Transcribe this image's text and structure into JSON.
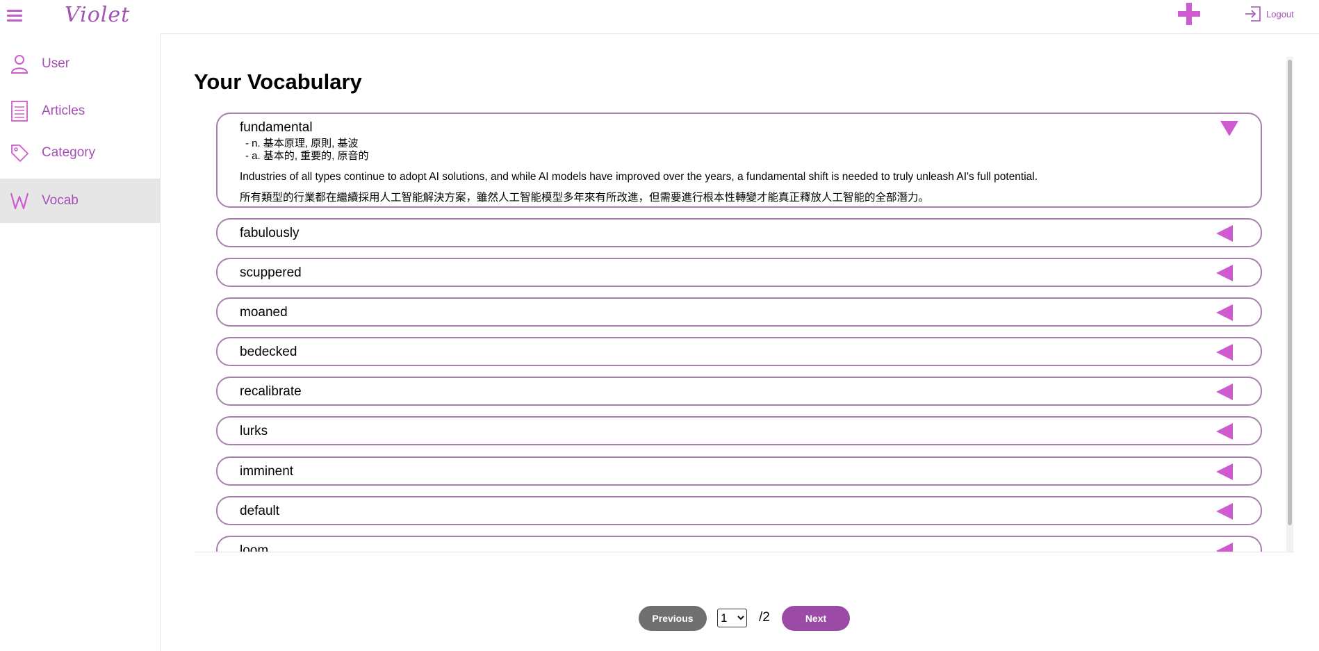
{
  "app": {
    "logo": "Violet",
    "brand_color": "#a450b5",
    "accent_color": "#cf5bd0"
  },
  "header": {
    "menu_icon": "hamburger-icon",
    "add_icon": "plus-icon",
    "logout_icon": "logout-icon",
    "logout_label": "Logout"
  },
  "sidebar": {
    "items": [
      {
        "label": "User",
        "icon": "user-icon",
        "active": false
      },
      {
        "label": "Articles",
        "icon": "document-icon",
        "active": false
      },
      {
        "label": "Category",
        "icon": "tag-icon",
        "active": false
      },
      {
        "label": "Vocab",
        "icon": "w-letter-icon",
        "active": true
      }
    ]
  },
  "main": {
    "title": "Your Vocabulary",
    "expanded": {
      "word": "fundamental",
      "definitions": [
        "-  n. 基本原理, 原則, 基波",
        "-  a. 基本的, 重要的, 原音的"
      ],
      "example_en": "Industries of all types continue to adopt AI solutions, and while AI models have improved over the years, a fundamental shift is needed to truly unleash AI's full potential.",
      "example_zh": "所有類型的行業都在繼續採用人工智能解決方案，雖然人工智能模型多年來有所改進，但需要進行根本性轉變才能真正釋放人工智能的全部潛力。"
    },
    "words": [
      "fabulously",
      "scuppered",
      "moaned",
      "bedecked",
      "recalibrate",
      "lurks",
      "imminent",
      "default",
      "loom"
    ]
  },
  "pagination": {
    "previous_label": "Previous",
    "next_label": "Next",
    "current_page": "1",
    "total_label": "/2",
    "options": [
      "1",
      "2"
    ]
  }
}
